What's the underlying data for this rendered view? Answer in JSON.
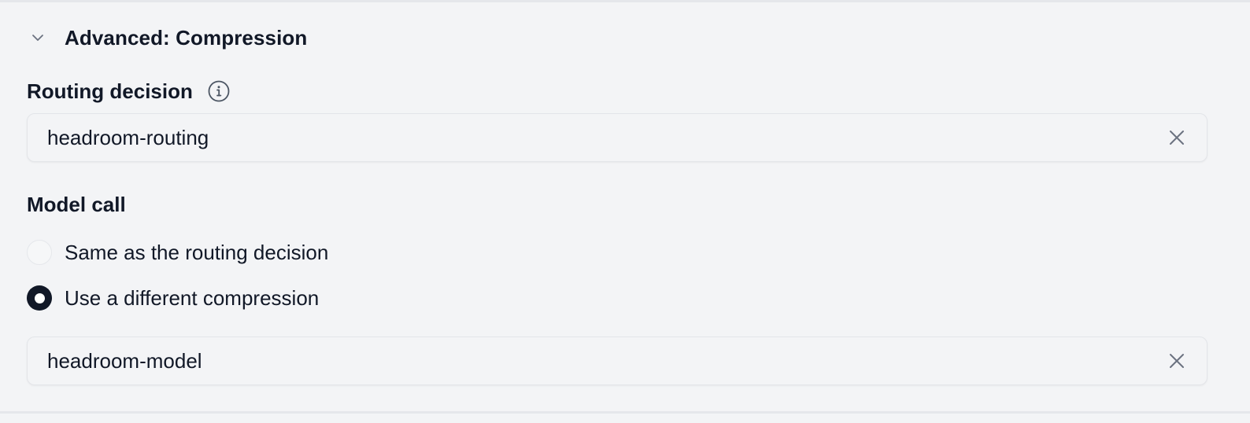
{
  "section": {
    "title": "Advanced: Compression",
    "chevron_icon": "chevron-down-icon"
  },
  "routing": {
    "label": "Routing decision",
    "info_icon": "info-icon",
    "value": "headroom-routing",
    "clear_icon": "close-icon"
  },
  "model_call": {
    "label": "Model call",
    "options": [
      {
        "label": "Same as the routing decision",
        "selected": false
      },
      {
        "label": "Use a different compression",
        "selected": true
      }
    ],
    "value": "headroom-model",
    "clear_icon": "close-icon"
  },
  "colors": {
    "background": "#f3f4f6",
    "text": "#111827",
    "border": "#e3e5e9",
    "icon": "#6b7280"
  }
}
